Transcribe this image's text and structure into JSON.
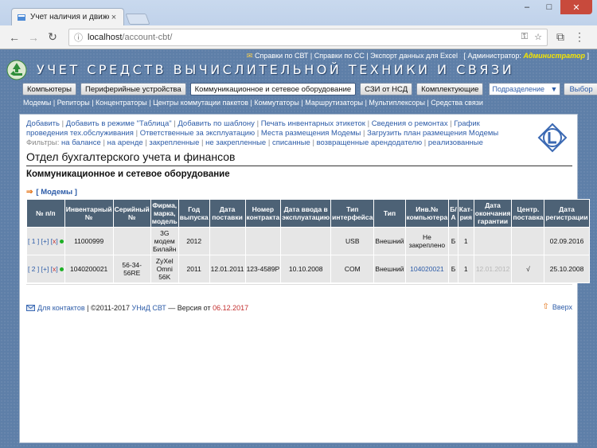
{
  "browser": {
    "tab_title": "Учет наличия и движен",
    "tab_close": "×",
    "url_host": "localhost",
    "url_path": "/account-cbt/",
    "win_min": "–",
    "win_max": "□",
    "win_close": "✕"
  },
  "header": {
    "toplinks": {
      "item1": "Справки по СВТ",
      "item2": "Справки по СС",
      "item3": "Экспорт данных для Excel",
      "admin_label": "Администратор:",
      "admin_value": "Администратор"
    },
    "title": "УЧЕТ СРЕДСТВ ВЫЧИСЛИТЕЛЬНОЙ ТЕХНИКИ И СВЯЗИ",
    "nav": [
      "Компьютеры",
      "Периферийные устройства",
      "Коммуникационное и сетевое оборудование",
      "СЗИ от НСД",
      "Комплектующие"
    ],
    "select_value": "Подразделение",
    "select_arrow": "▼",
    "choose_label": "Выбор",
    "subnav": [
      "Модемы",
      "Репиторы",
      "Концентраторы",
      "Центры коммутации пакетов",
      "Коммутаторы",
      "Маршрутизаторы",
      "Мультиплексоры",
      "Средства связи"
    ]
  },
  "actions": {
    "links": [
      "Добавить",
      "Добавить в режиме \"Таблица\"",
      "Добавить по шаблону",
      "Печать инвентарных этикеток",
      "Сведения о ремонтах",
      "График проведения тех.обслуживания",
      "Ответственные за эксплуатацию",
      "Места размещения Модемы",
      "Загрузить план размещения Модемы"
    ],
    "filters_label": "Фильтры:",
    "filters": [
      "на балансе",
      "на аренде",
      "закрепленные",
      "не закрепленные",
      "списанные",
      "возвращенные арендодателю",
      "реализованные"
    ]
  },
  "content": {
    "dept_title": "Отдел бухгалтерского учета и финансов",
    "section_title": "Коммуникационное и сетевое оборудование",
    "subsection": "[ Модемы ]",
    "arrow": "⇒"
  },
  "table": {
    "headers": [
      "№ п/п",
      "Инвентарный №",
      "Серийный №",
      "Фирма, марка, модель",
      "Год выпуска",
      "Дата поставки",
      "Номер контракта",
      "Дата ввода в эксплуатацию",
      "Тип интерфейса",
      "Тип",
      "Инв.№ компьютера",
      "Б/А",
      "Кат-рия",
      "Дата окончания гарантии",
      "Центр. поставка",
      "Дата регистрации"
    ],
    "rows": [
      {
        "num": "1",
        "plus": "+",
        "x": "x",
        "inv": "11000999",
        "serial": "",
        "model": "3G модем Билайн",
        "year": "2012",
        "supply": "",
        "contract": "",
        "commission": "",
        "iface": "USB",
        "type": "Внешний",
        "comp": "Не закреплено",
        "ba": "Б",
        "cat": "1",
        "warranty": "",
        "central": "",
        "reg": "02.09.2016"
      },
      {
        "num": "2",
        "plus": "+",
        "x": "x",
        "inv": "1040200021",
        "serial": "56-34-56RE",
        "model": "ZyXel Omni 56K",
        "year": "2011",
        "supply": "12.01.2011",
        "contract": "123-4589Р",
        "commission": "10.10.2008",
        "iface": "COM",
        "type": "Внешний",
        "comp": "104020021",
        "ba": "Б",
        "cat": "1",
        "warranty": "12.01.2012",
        "central": "√",
        "reg": "25.10.2008"
      }
    ]
  },
  "footer": {
    "contacts": "Для контактов",
    "copyright": "| ©2011-2017",
    "product": "УНиД СВТ",
    "version_prefix": "— Версия от",
    "version_date": "06.12.2017",
    "up": "Вверх",
    "up_arrow": "⇧"
  },
  "colors": {
    "page_bg": "#5e7fa8",
    "header_bg": "#4d6276",
    "link": "#2d5ca8",
    "accent_orange": "#e36d0c",
    "status_green": "#1db025",
    "admin_yellow": "#f5e500"
  }
}
